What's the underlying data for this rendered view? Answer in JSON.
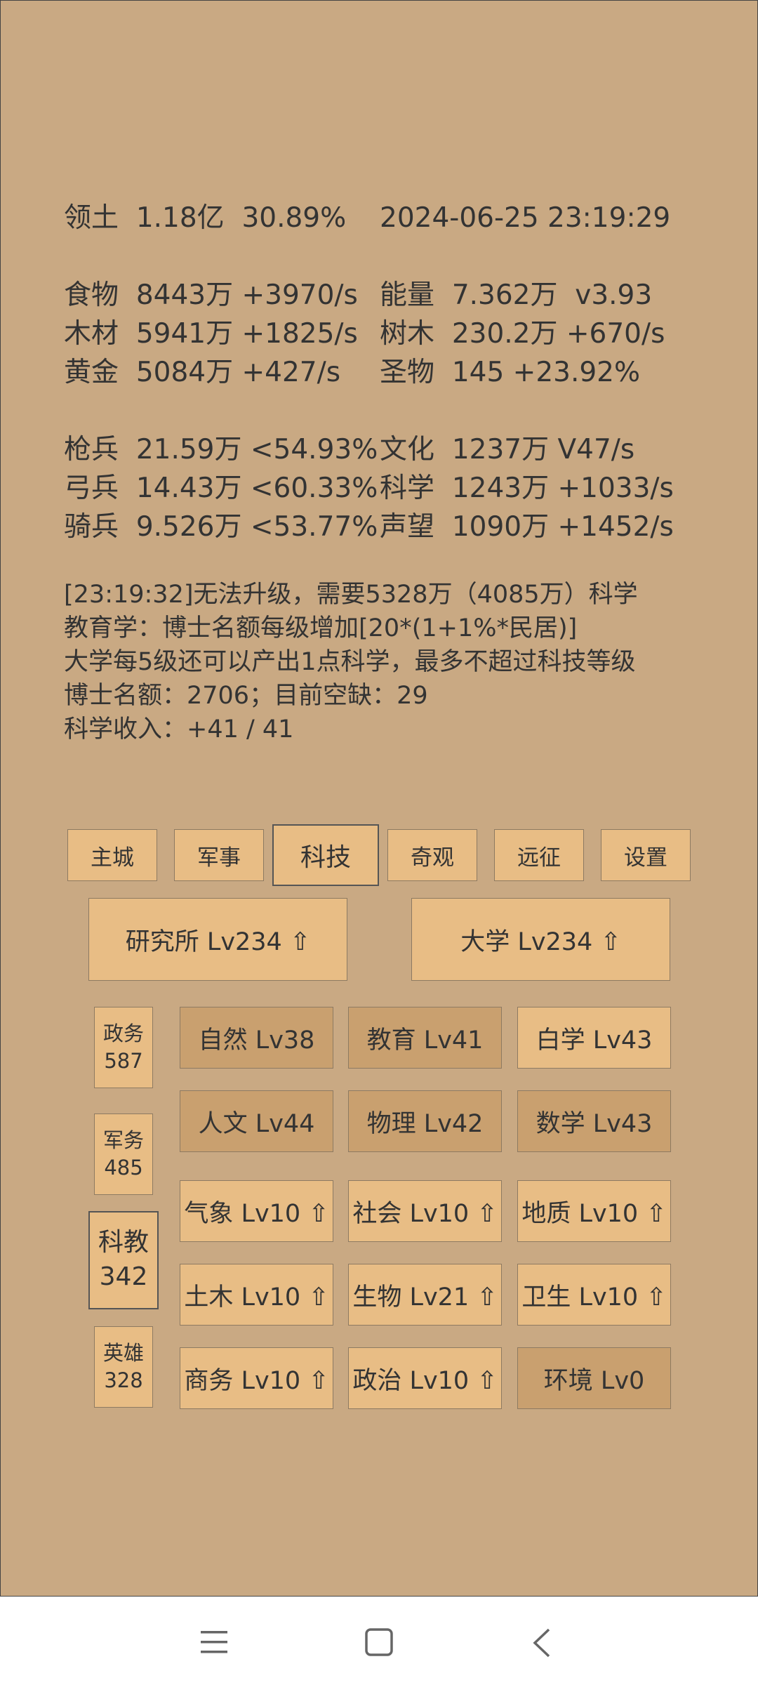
{
  "stats": {
    "territory": {
      "label": "领土",
      "value": "1.18亿",
      "pct": "30.89%"
    },
    "datetime": "2024-06-25 23:19:29",
    "food": {
      "label": "食物",
      "value": "8443万",
      "rate": "+3970/s"
    },
    "energy": {
      "label": "能量",
      "value": "7.362万",
      "rate": "v3.93"
    },
    "wood": {
      "label": "木材",
      "value": "5941万",
      "rate": "+1825/s"
    },
    "trees": {
      "label": "树木",
      "value": "230.2万",
      "rate": "+670/s"
    },
    "gold": {
      "label": "黄金",
      "value": "5084万",
      "rate": "+427/s"
    },
    "relic": {
      "label": "圣物",
      "value": "145",
      "rate": "+23.92%"
    },
    "spear": {
      "label": "枪兵",
      "value": "21.59万",
      "rate": "<54.93%"
    },
    "culture": {
      "label": "文化",
      "value": "1237万",
      "rate": "V47/s"
    },
    "archer": {
      "label": "弓兵",
      "value": "14.43万",
      "rate": "<60.33%"
    },
    "science": {
      "label": "科学",
      "value": "1243万",
      "rate": "+1033/s"
    },
    "cavalry": {
      "label": "骑兵",
      "value": "9.526万",
      "rate": "<53.77%"
    },
    "prestige": {
      "label": "声望",
      "value": "1090万",
      "rate": "+1452/s"
    }
  },
  "messages": [
    "[23:19:32]无法升级，需要5328万（4085万）科学",
    "教育学：博士名额每级增加[20*(1+1%*民居)]",
    "大学每5级还可以产出1点科学，最多不超过科技等级",
    "博士名额：2706；目前空缺：29",
    "科学收入：+41 / 41"
  ],
  "tabs": [
    "主城",
    "军事",
    "科技",
    "奇观",
    "远征",
    "设置"
  ],
  "selected_tab": "科技",
  "buildings": [
    "研究所 Lv234 ⇧",
    "大学 Lv234 ⇧"
  ],
  "side": [
    {
      "name": "政务",
      "count": "587"
    },
    {
      "name": "军务",
      "count": "485"
    },
    {
      "name": "科教",
      "count": "342"
    },
    {
      "name": "英雄",
      "count": "328"
    }
  ],
  "techs": [
    [
      "自然 Lv38",
      "教育 Lv41",
      "白学 Lv43"
    ],
    [
      "人文 Lv44",
      "物理 Lv42",
      "数学 Lv43"
    ],
    [
      "气象 Lv10 ⇧",
      "社会 Lv10 ⇧",
      "地质 Lv10 ⇧"
    ],
    [
      "土木 Lv10 ⇧",
      "生物 Lv21 ⇧",
      "卫生 Lv10 ⇧"
    ],
    [
      "商务 Lv10 ⇧",
      "政治 Lv10 ⇧",
      "环境 Lv0"
    ]
  ],
  "colors": {
    "background": "#c9a983",
    "button_light": "#e8bd85",
    "button_dark": "#c9a06f"
  },
  "nav_icons": [
    "menu-icon",
    "home-icon",
    "back-icon"
  ]
}
